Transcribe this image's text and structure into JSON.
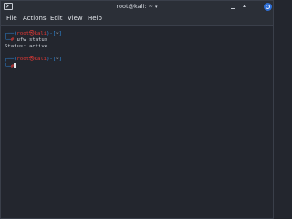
{
  "window": {
    "title": "root@kali: ~",
    "title_caret": "▾",
    "icons": {
      "app": "terminal-icon",
      "minimize": "minimize-icon",
      "maximize": "maximize-icon",
      "close": "close-icon"
    }
  },
  "menu": {
    "items": [
      {
        "label": "File"
      },
      {
        "label": "Actions"
      },
      {
        "label": "Edit"
      },
      {
        "label": "View"
      },
      {
        "label": "Help"
      }
    ]
  },
  "terminal": {
    "prompt1": {
      "bracket_open": "┌──(",
      "user": "root",
      "at": "㉿",
      "host": "kali",
      "bracket_mid": ")-[",
      "path": "~",
      "bracket_close": "]",
      "line2_prefix": "└─",
      "symbol": "#",
      "command": " ufw status"
    },
    "output1": "Status: active",
    "prompt2": {
      "bracket_open": "┌──(",
      "user": "root",
      "at": "㉿",
      "host": "kali",
      "bracket_mid": ")-[",
      "path": "~",
      "bracket_close": "]",
      "line2_prefix": "└─",
      "symbol": "#"
    }
  },
  "colors": {
    "background": "#23262e",
    "prompt_blue": "#2f8fe6",
    "prompt_red": "#e53935",
    "text": "#d6dae0",
    "close_button": "#2f6fd6"
  }
}
